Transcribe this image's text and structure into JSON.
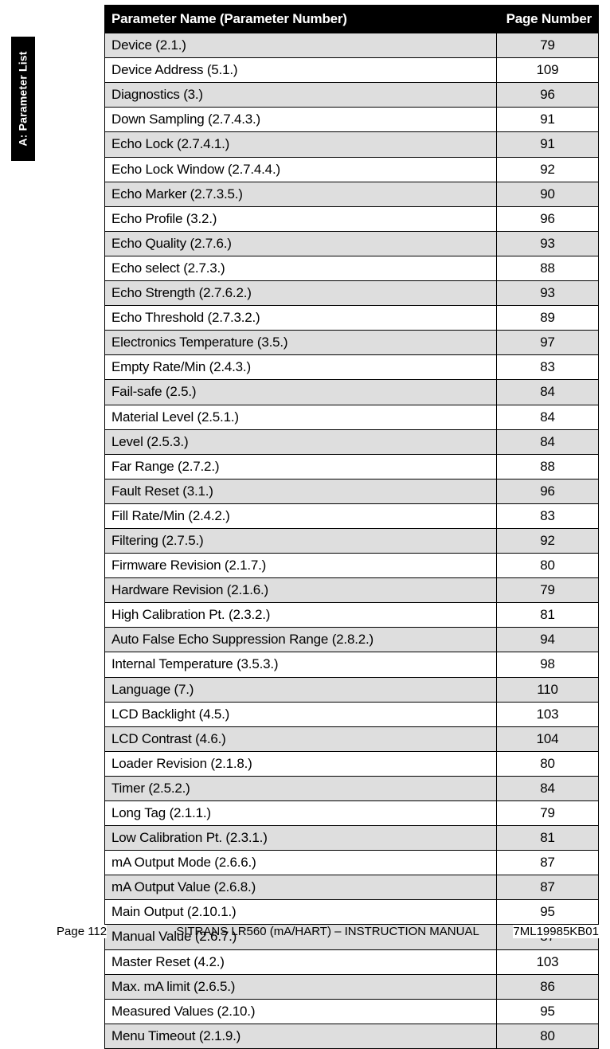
{
  "side_tab": "A: Parameter List",
  "headers": {
    "name": "Parameter Name (Parameter Number)",
    "page": "Page Number"
  },
  "rows": [
    {
      "name": "Device (2.1.)",
      "page": 79
    },
    {
      "name": "Device Address (5.1.)",
      "page": 109
    },
    {
      "name": "Diagnostics (3.)",
      "page": 96
    },
    {
      "name": "Down Sampling (2.7.4.3.)",
      "page": 91
    },
    {
      "name": "Echo Lock (2.7.4.1.)",
      "page": 91
    },
    {
      "name": "Echo Lock Window (2.7.4.4.)",
      "page": 92
    },
    {
      "name": "Echo Marker (2.7.3.5.)",
      "page": 90
    },
    {
      "name": "Echo Profile (3.2.)",
      "page": 96
    },
    {
      "name": "Echo Quality (2.7.6.)",
      "page": 93
    },
    {
      "name": "Echo select (2.7.3.)",
      "page": 88
    },
    {
      "name": "Echo Strength (2.7.6.2.)",
      "page": 93
    },
    {
      "name": "Echo Threshold (2.7.3.2.)",
      "page": 89
    },
    {
      "name": "Electronics Temperature (3.5.)",
      "page": 97
    },
    {
      "name": "Empty Rate/Min (2.4.3.)",
      "page": 83
    },
    {
      "name": "Fail-safe (2.5.)",
      "page": 84
    },
    {
      "name": "Material Level (2.5.1.)",
      "page": 84
    },
    {
      "name": "Level (2.5.3.)",
      "page": 84
    },
    {
      "name": "Far Range (2.7.2.)",
      "page": 88
    },
    {
      "name": "Fault Reset (3.1.)",
      "page": 96
    },
    {
      "name": "Fill Rate/Min (2.4.2.)",
      "page": 83
    },
    {
      "name": "Filtering (2.7.5.)",
      "page": 92
    },
    {
      "name": "Firmware Revision (2.1.7.)",
      "page": 80
    },
    {
      "name": "Hardware Revision (2.1.6.)",
      "page": 79
    },
    {
      "name": "High Calibration Pt. (2.3.2.)",
      "page": 81
    },
    {
      "name": "Auto False Echo Suppression Range (2.8.2.)",
      "page": 94
    },
    {
      "name": "Internal Temperature (3.5.3.)",
      "page": 98
    },
    {
      "name": "Language (7.)",
      "page": 110
    },
    {
      "name": "LCD Backlight (4.5.)",
      "page": 103
    },
    {
      "name": "LCD Contrast (4.6.)",
      "page": 104
    },
    {
      "name": "Loader Revision (2.1.8.)",
      "page": 80
    },
    {
      "name": "Timer (2.5.2.)",
      "page": 84
    },
    {
      "name": "Long Tag (2.1.1.)",
      "page": 79
    },
    {
      "name": "Low Calibration Pt. (2.3.1.)",
      "page": 81
    },
    {
      "name": "mA Output Mode (2.6.6.)",
      "page": 87
    },
    {
      "name": "mA Output Value (2.6.8.)",
      "page": 87
    },
    {
      "name": "Main Output (2.10.1.)",
      "page": 95
    },
    {
      "name": "Manual Value (2.6.7.)",
      "page": 87
    },
    {
      "name": "Master Reset (4.2.)",
      "page": 103
    },
    {
      "name": "Max. mA limit (2.6.5.)",
      "page": 86
    },
    {
      "name": "Measured Values (2.10.)",
      "page": 95
    },
    {
      "name": "Menu Timeout (2.1.9.)",
      "page": 80
    }
  ],
  "footer": {
    "left": "Page 112",
    "center": "SITRANS LR560 (mA/HART) – INSTRUCTION MANUAL",
    "right": "7ML19985KB01"
  }
}
